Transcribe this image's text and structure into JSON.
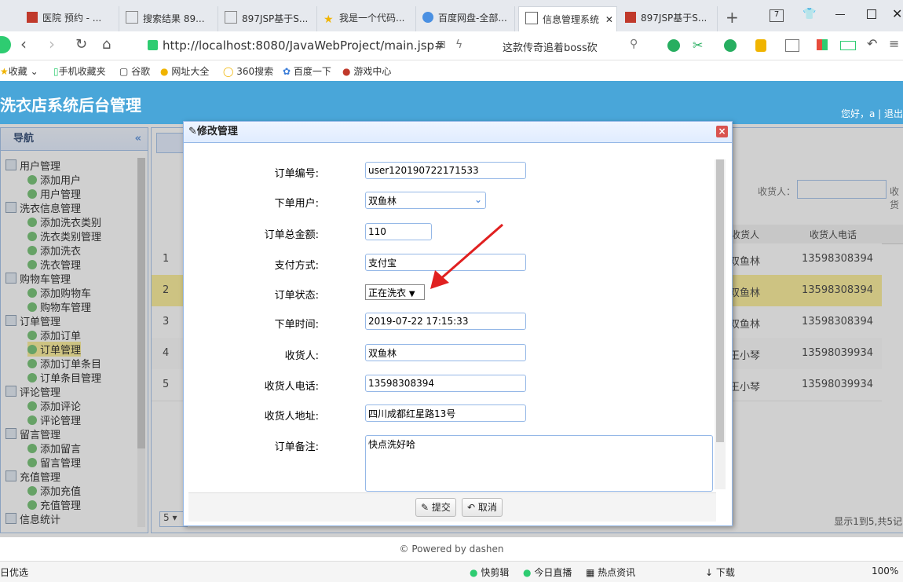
{
  "browser": {
    "tabs": [
      "医院 预约 - ...",
      "搜索结果 89...",
      "897JSP基于S...",
      "我是一个代码...",
      "百度网盘-全部...",
      "信息管理系统",
      "897JSP基于S..."
    ],
    "new_tab": "+",
    "url": "http://localhost:8080/JavaWebProject/main.jsp#",
    "search_hint": "这款传奇追着boss砍",
    "bookmarks": [
      "收藏",
      "手机收藏夹",
      "谷歌",
      "网址大全",
      "360搜索",
      "百度一下",
      "游戏中心"
    ]
  },
  "app": {
    "title": "洗衣店系统后台管理",
    "greeting": "您好，a | 退出",
    "footer": "© Powered by dashen"
  },
  "sidebar": {
    "title": "导航",
    "collapse": "«",
    "items": [
      {
        "label": "用户管理",
        "level": 0
      },
      {
        "label": "添加用户",
        "level": 1
      },
      {
        "label": "用户管理",
        "level": 1
      },
      {
        "label": "洗衣信息管理",
        "level": 0
      },
      {
        "label": "添加洗衣类别",
        "level": 1
      },
      {
        "label": "洗衣类别管理",
        "level": 1
      },
      {
        "label": "添加洗衣",
        "level": 1
      },
      {
        "label": "洗衣管理",
        "level": 1
      },
      {
        "label": "购物车管理",
        "level": 0
      },
      {
        "label": "添加购物车",
        "level": 1
      },
      {
        "label": "购物车管理",
        "level": 1
      },
      {
        "label": "订单管理",
        "level": 0
      },
      {
        "label": "添加订单",
        "level": 1
      },
      {
        "label": "订单管理",
        "level": 1,
        "selected": true
      },
      {
        "label": "添加订单条目",
        "level": 1
      },
      {
        "label": "订单条目管理",
        "level": 1
      },
      {
        "label": "评论管理",
        "level": 0
      },
      {
        "label": "添加评论",
        "level": 1
      },
      {
        "label": "评论管理",
        "level": 1
      },
      {
        "label": "留言管理",
        "level": 0
      },
      {
        "label": "添加留言",
        "level": 1
      },
      {
        "label": "留言管理",
        "level": 1
      },
      {
        "label": "充值管理",
        "level": 0
      },
      {
        "label": "添加充值",
        "level": 1
      },
      {
        "label": "充值管理",
        "level": 1
      },
      {
        "label": "信息统计",
        "level": 0
      }
    ]
  },
  "grid": {
    "search_label": "收货人：",
    "search_label2": "收货",
    "columns": [
      "收货人",
      "收货人电话"
    ],
    "rows": [
      {
        "num": "1",
        "receiver": "双鱼林",
        "phone": "13598308394"
      },
      {
        "num": "2",
        "receiver": "双鱼林",
        "phone": "13598308394"
      },
      {
        "num": "3",
        "receiver": "双鱼林",
        "phone": "13598308394"
      },
      {
        "num": "4",
        "receiver": "王小琴",
        "phone": "13598039934"
      },
      {
        "num": "5",
        "receiver": "王小琴",
        "phone": "13598039934"
      }
    ],
    "page_size": "5",
    "pager_info": "显示1到5,共5记"
  },
  "dialog": {
    "title": "修改管理",
    "close": "×",
    "fields": {
      "order_no_label": "订单编号:",
      "order_no": "user120190722171533",
      "user_label": "下单用户:",
      "user": "双鱼林",
      "amount_label": "订单总金额:",
      "amount": "110",
      "pay_label": "支付方式:",
      "pay": "支付宝",
      "status_label": "订单状态:",
      "status": "正在洗衣",
      "time_label": "下单时间:",
      "time": "2019-07-22 17:15:33",
      "receiver_label": "收货人:",
      "receiver": "双鱼林",
      "phone_label": "收货人电话:",
      "phone": "13598308394",
      "address_label": "收货人地址:",
      "address": "四川成都红星路13号",
      "memo_label": "订单备注:",
      "memo": "快点洗好哈"
    },
    "submit": "提交",
    "cancel": "取消"
  },
  "statusbar": {
    "left": "日优选",
    "items": [
      "快剪辑",
      "今日直播",
      "热点资讯",
      "下载",
      "100%"
    ]
  },
  "colors": {
    "header_bg": "#49a6d9",
    "selected_row": "#fbec88",
    "annotation_arrow": "#e02020"
  }
}
